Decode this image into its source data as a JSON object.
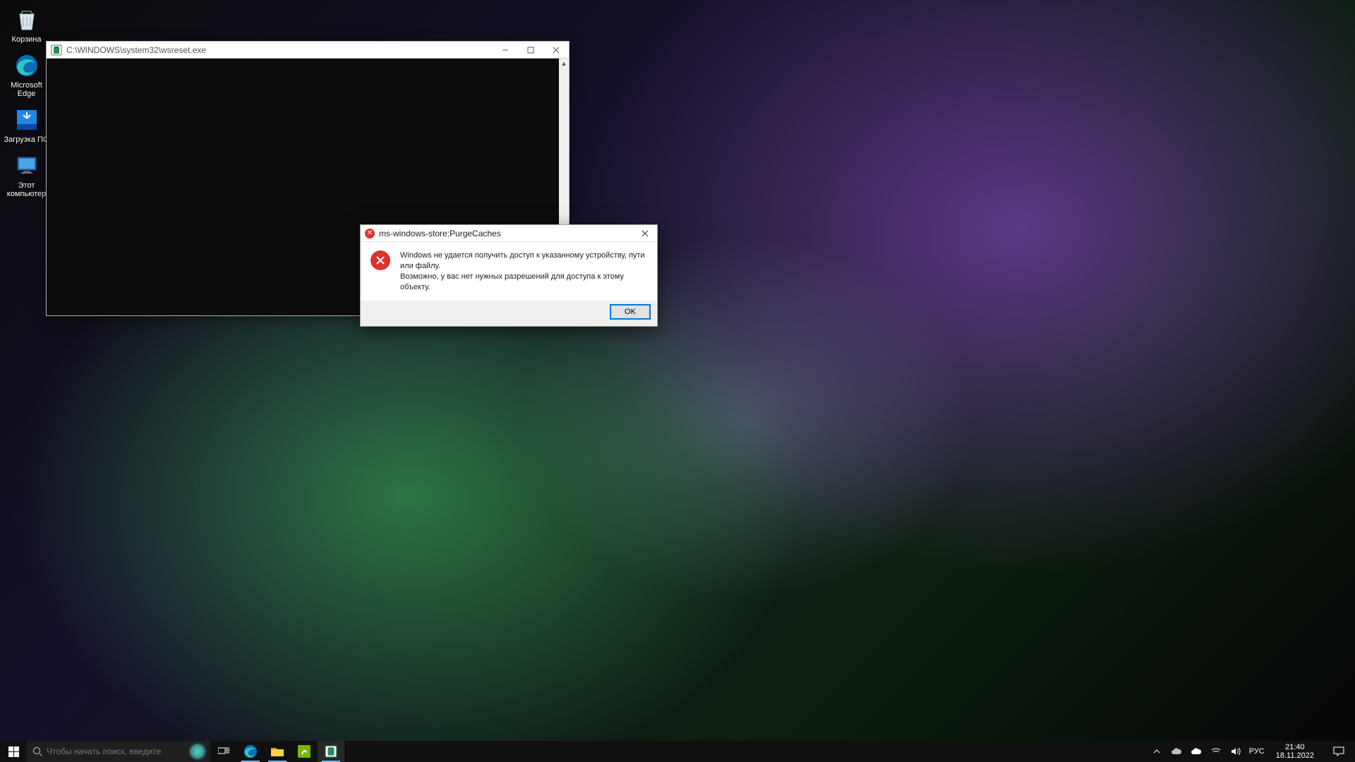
{
  "desktop_icons": [
    {
      "name": "recycle-bin",
      "label": "Корзина"
    },
    {
      "name": "microsoft-edge",
      "label": "Microsoft Edge"
    },
    {
      "name": "download-software",
      "label": "Загрузка ПО"
    },
    {
      "name": "this-pc",
      "label": "Этот компьютер"
    }
  ],
  "console_window": {
    "title": "C:\\WINDOWS\\system32\\wsreset.exe"
  },
  "error_dialog": {
    "title": "ms-windows-store:PurgeCaches",
    "line1": "Windows не удается получить доступ к указанному устройству, пути или файлу.",
    "line2": "Возможно, у вас нет нужных разрешений для доступа к этому объекту.",
    "ok_label": "OK"
  },
  "taskbar": {
    "search_placeholder": "Чтобы начать поиск, введите",
    "lang": "РУС",
    "time": "21:40",
    "date": "18.11.2022"
  }
}
